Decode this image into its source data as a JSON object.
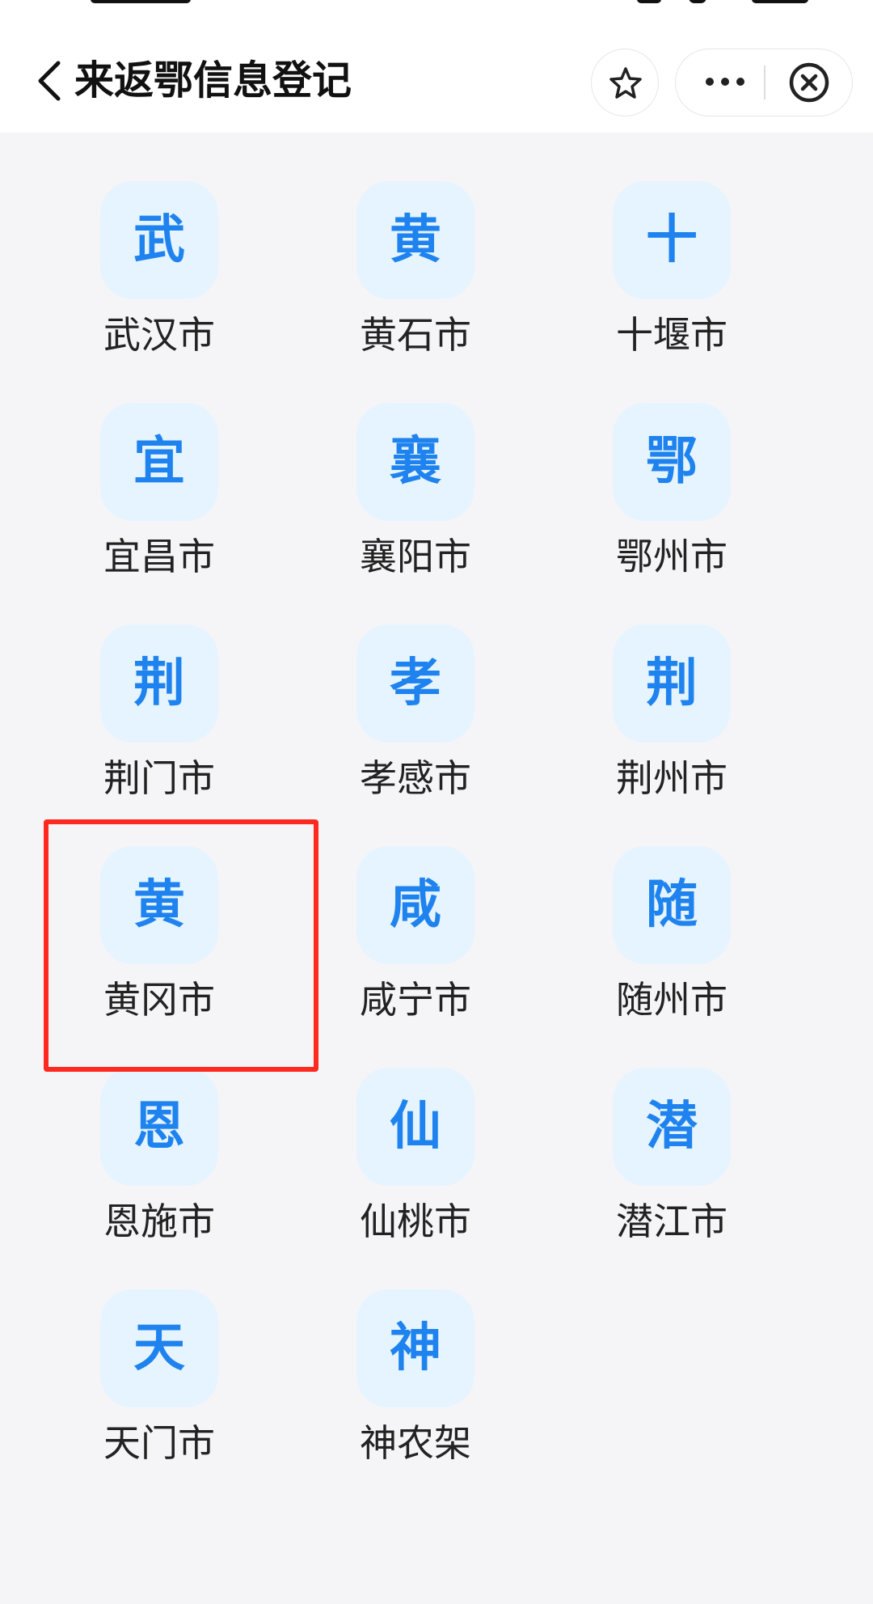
{
  "header": {
    "title": "来返鄂信息登记",
    "back_icon": "chevron-left-icon",
    "star_icon": "star-icon",
    "more_icon": "more-dots-icon",
    "close_icon": "close-circle-icon"
  },
  "colors": {
    "icon_bg": "#e6f4ff",
    "icon_char": "#1f83ef",
    "highlight": "#ff2a1f"
  },
  "cities": [
    {
      "char": "武",
      "name": "武汉市"
    },
    {
      "char": "黄",
      "name": "黄石市"
    },
    {
      "char": "十",
      "name": "十堰市"
    },
    {
      "char": "宜",
      "name": "宜昌市"
    },
    {
      "char": "襄",
      "name": "襄阳市"
    },
    {
      "char": "鄂",
      "name": "鄂州市"
    },
    {
      "char": "荆",
      "name": "荆门市"
    },
    {
      "char": "孝",
      "name": "孝感市"
    },
    {
      "char": "荆",
      "name": "荆州市"
    },
    {
      "char": "黄",
      "name": "黄冈市",
      "highlighted": true
    },
    {
      "char": "咸",
      "name": "咸宁市"
    },
    {
      "char": "随",
      "name": "随州市"
    },
    {
      "char": "恩",
      "name": "恩施市"
    },
    {
      "char": "仙",
      "name": "仙桃市"
    },
    {
      "char": "潜",
      "name": "潜江市"
    },
    {
      "char": "天",
      "name": "天门市"
    },
    {
      "char": "神",
      "name": "神农架"
    }
  ]
}
